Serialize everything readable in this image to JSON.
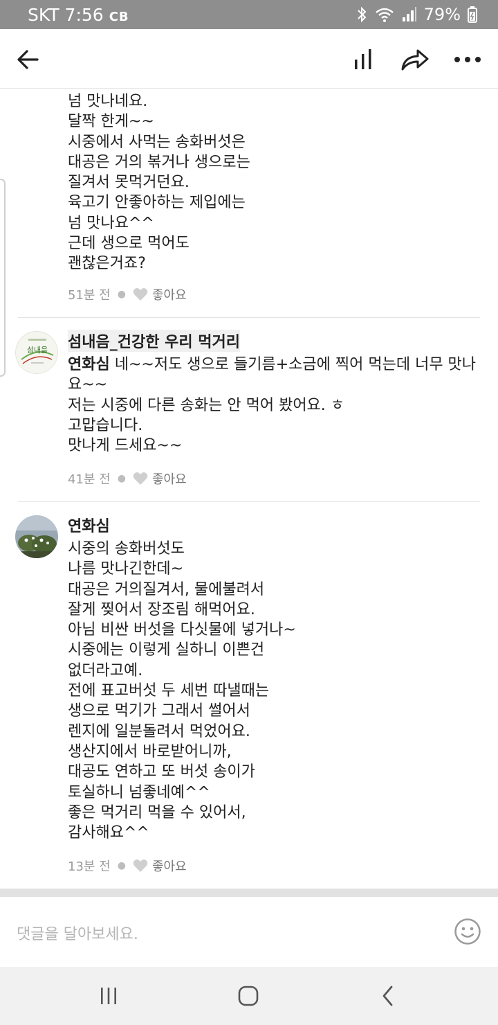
{
  "status_bar": {
    "carrier_time": "SKT 7:56",
    "carrier_extra": "CB",
    "battery": "79%"
  },
  "app_bar": {
    "icons": [
      "back-arrow-icon",
      "stats-icon",
      "share-icon",
      "more-icon"
    ]
  },
  "comments": [
    {
      "author": "",
      "mention": "",
      "text": "넘 맛나네요.\n달짝 한게~~\n시중에서 사먹는 송화버섯은\n대공은 거의 볶거나 생으로는\n질겨서 못먹거던요.\n육고기 안좋아하는 제입에는\n넘 맛나요^^\n근데 생으로 먹어도\n괜찮은거죠?",
      "time": "51분 전",
      "like_label": "좋아요"
    },
    {
      "author": "섬내음_건강한 우리 먹거리",
      "mention": "연화심",
      "text": " 네~~저도 생으로 들기름+소금에 찍어 먹는데 너무 맛나요~~\n저는 시중에 다른 송화는 안 먹어 봤어요. ㅎ\n고맙습니다.\n맛나게 드세요~~",
      "time": "41분 전",
      "like_label": "좋아요",
      "avatar_text": "섬내음"
    },
    {
      "author": "연화심",
      "mention": "",
      "text": "시중의 송화버섯도\n나름 맛나긴한데~\n대공은 거의질겨서, 물에불려서\n잘게 찢어서  장조림 해먹어요.\n아님 비싼 버섯을 다싯물에 넣거나~\n시중에는 이렇게 실하니 이쁜건\n없더라고예.\n전에 표고버섯 두 세번 따낼때는\n생으로 먹기가 그래서  썰어서\n렌지에 일분돌려서 먹었어요.\n생산지에서 바로받어니까,\n대공도 연하고  또 버섯 송이가\n토실하니 넘좋네예^^\n좋은 먹거리 먹을 수 있어서,\n감사해요^^",
      "time": "13분 전",
      "like_label": "좋아요"
    }
  ],
  "input": {
    "placeholder": "댓글을 달아보세요."
  },
  "nav_bar": {
    "icons": [
      "recent-apps-icon",
      "home-icon",
      "back-icon"
    ]
  },
  "colors": {
    "status_bar": "#8e8e8e",
    "meta_text": "#9a9a9a",
    "divider": "#e3e3e3"
  }
}
